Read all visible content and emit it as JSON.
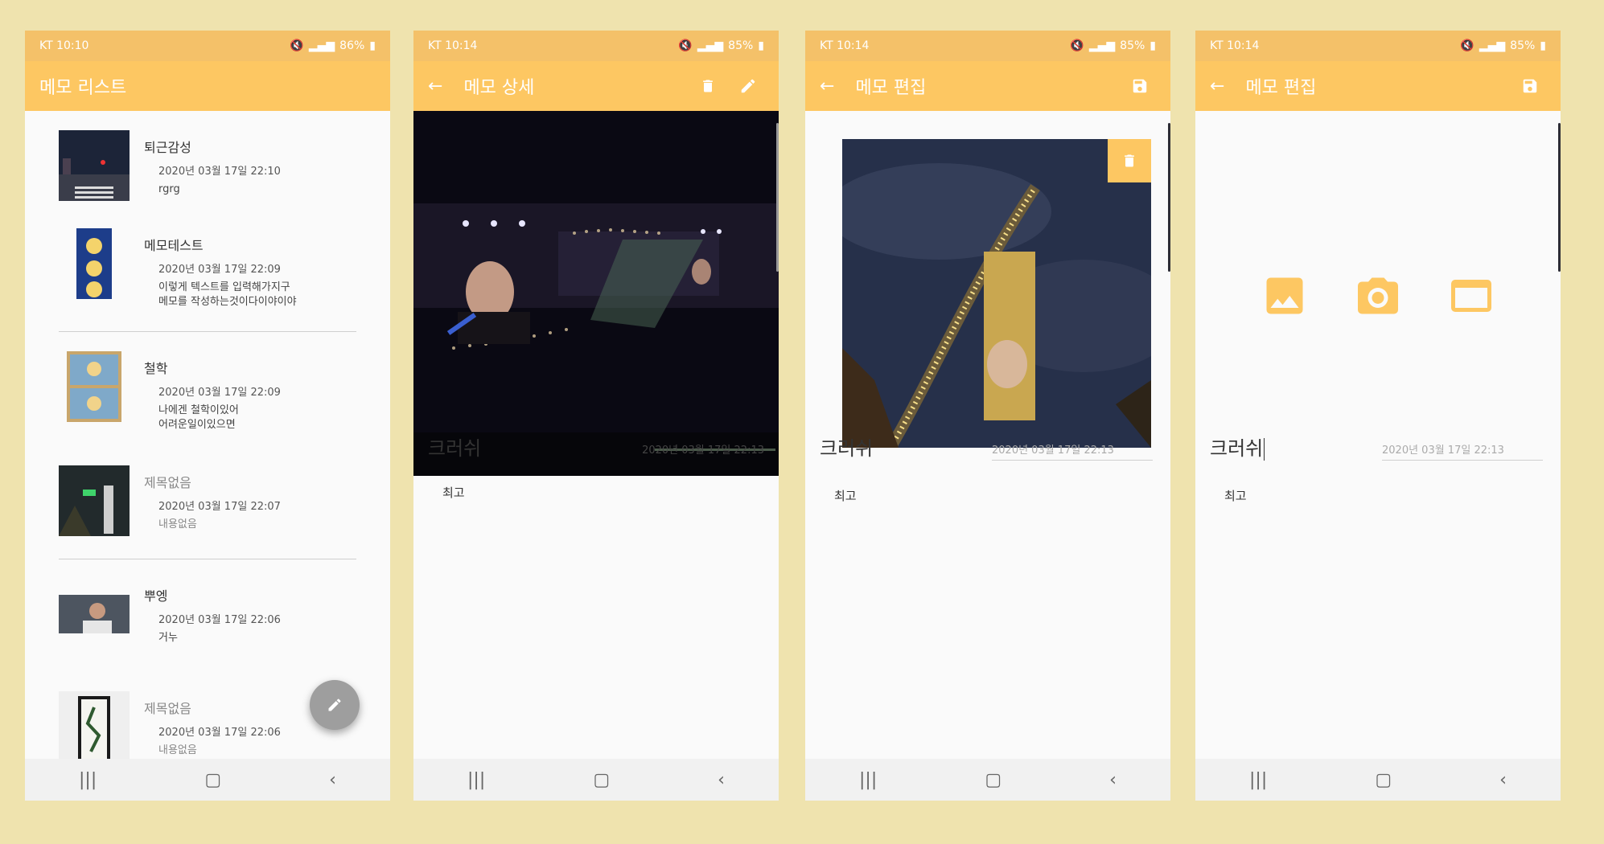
{
  "status_bars": [
    {
      "left": "KT 10:10",
      "battery": "86%"
    },
    {
      "left": "KT 10:14",
      "battery": "85%"
    },
    {
      "left": "KT 10:14",
      "battery": "85%"
    },
    {
      "left": "KT 10:14",
      "battery": "85%"
    }
  ],
  "screen1": {
    "title": "메모 리스트",
    "items": [
      {
        "title": "퇴근감성",
        "date": "2020년 03월 17일 22:10",
        "body": "rgrg"
      },
      {
        "title": "메모테스트",
        "date": "2020년 03월 17일 22:09",
        "body": " 이렇게 텍스트를 입력해가지구\n메모를 작성하는것이다이야이야"
      },
      {
        "title": "철학",
        "date": "2020년 03월 17일 22:09",
        "body": "나에겐 철학이있어\n어려운일이있으면"
      },
      {
        "title": "제목없음",
        "date": "2020년 03월 17일 22:07",
        "body": "내용없음"
      },
      {
        "title": "뿌엥",
        "date": "2020년 03월 17일 22:06",
        "body": "거누"
      },
      {
        "title": "제목없음",
        "date": "2020년 03월 17일 22:06",
        "body": "내용없음"
      }
    ]
  },
  "screen2": {
    "title": "메모 상세",
    "memo_title": "크러쉬",
    "date": "2020년 03월 17일 22:13",
    "body": "최고"
  },
  "screen3": {
    "title": "메모 편집",
    "memo_title": "크러쉬",
    "date": "2020년 03월 17일 22:13",
    "body": "최고"
  },
  "screen4": {
    "title": "메모 편집",
    "memo_title": "크러쉬",
    "date": "2020년 03월 17일 22:13",
    "body": "최고"
  },
  "icons": {
    "accent": "#fdc762",
    "picker": [
      "gallery-icon",
      "camera-icon",
      "frame-icon"
    ]
  }
}
